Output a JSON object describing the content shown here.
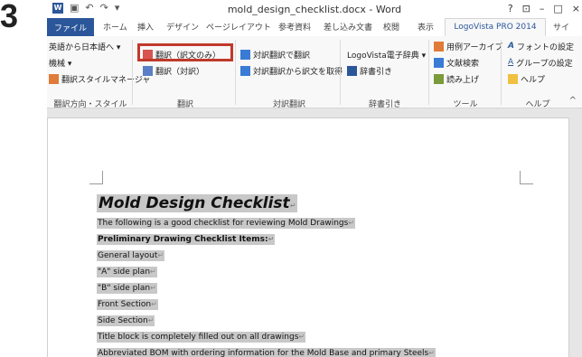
{
  "step_number": "3",
  "window": {
    "title": "mold_design_checklist.docx - Word",
    "controls": [
      "?",
      "⊡",
      "–",
      "□",
      "×"
    ],
    "qat_icon": "word-icon"
  },
  "tabs": {
    "file": "ファイル",
    "items": [
      "ホーム",
      "挿入",
      "デザイン",
      "ページレイアウト",
      "参考資料",
      "差し込み文書",
      "校閲",
      "表示"
    ],
    "active": "LogoVista PRO 2014",
    "trailing": "サイ"
  },
  "ribbon": {
    "col1": [
      "英語から日本語へ ▾",
      "機械 ▾",
      "翻訳スタイルマネージャ"
    ],
    "col2": [
      "翻訳（訳文のみ）",
      "翻訳（対訳）"
    ],
    "col3": [
      "対訳翻訳で翻訳",
      "対訳翻訳から訳文を取得"
    ],
    "col4": [
      "LogoVista電子辞典 ▾",
      "辞書引き"
    ],
    "col5": [
      "用例アーカイブ",
      "文献検索",
      "読み上げ"
    ],
    "col6": [
      "フォントの設定",
      "グループの設定",
      "ヘルプ"
    ],
    "groups": [
      "翻訳方向・スタイル",
      "翻訳",
      "対訳翻訳",
      "辞書引き",
      "ツール",
      "ヘルプ"
    ]
  },
  "document": {
    "title": "Mold Design Checklist",
    "lines": [
      {
        "text": "The following is a good checklist for reviewing Mold Drawings",
        "bold": false
      },
      {
        "text": "Preliminary Drawing Checklist Items:",
        "bold": true
      },
      {
        "text": "General layout",
        "bold": false
      },
      {
        "text": "\"A\" side plan",
        "bold": false
      },
      {
        "text": "\"B\" side plan",
        "bold": false
      },
      {
        "text": "Front Section",
        "bold": false
      },
      {
        "text": "Side Section",
        "bold": false
      },
      {
        "text": "Title block is completely filled out on all drawings",
        "bold": false
      },
      {
        "text": "Abbreviated BOM with ordering information for the Mold Base and primary Steels",
        "bold": false
      }
    ]
  },
  "colors": {
    "accent": "#2b579a",
    "highlight_box": "#c0392b",
    "selection": "#c8c8c8"
  }
}
